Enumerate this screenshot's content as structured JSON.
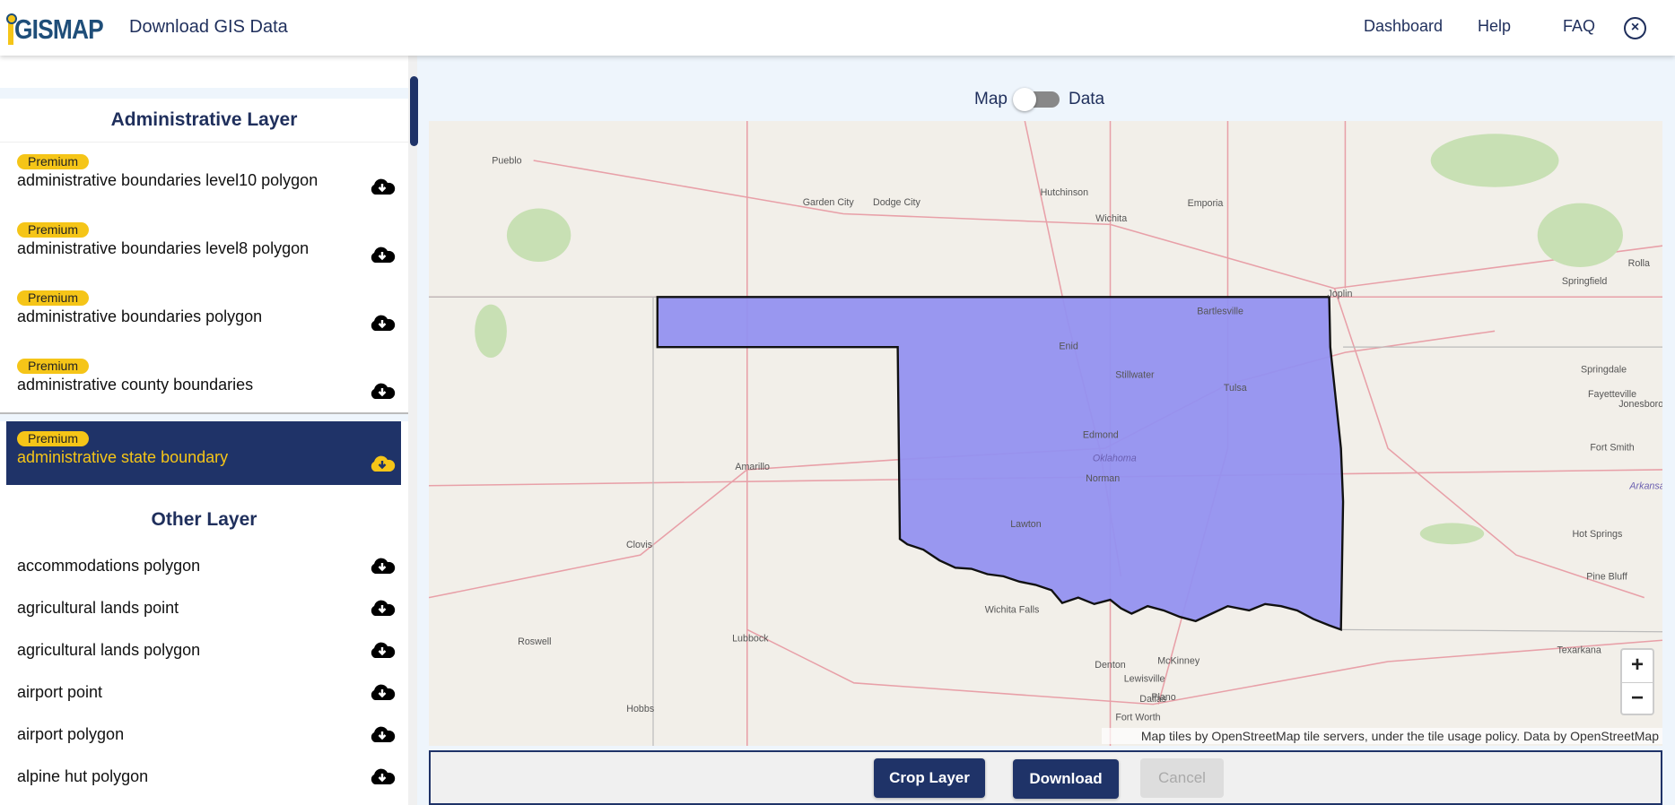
{
  "header": {
    "logo": "iGISMAP",
    "title": "Download GIS Data",
    "nav": [
      "Dashboard",
      "Help",
      "FAQ"
    ],
    "close_icon": "close-circle-icon"
  },
  "sidebar": {
    "admin_title": "Administrative Layer",
    "admin_items": [
      {
        "badge": "Premium",
        "label": "administrative boundaries level10 polygon"
      },
      {
        "badge": "Premium",
        "label": "administrative boundaries level8 polygon"
      },
      {
        "badge": "Premium",
        "label": "administrative boundaries polygon"
      },
      {
        "badge": "Premium",
        "label": "administrative county boundaries"
      },
      {
        "badge": "Premium",
        "label": "administrative state boundary",
        "selected": true
      }
    ],
    "other_title": "Other Layer",
    "other_items": [
      {
        "label": "accommodations polygon"
      },
      {
        "label": "agricultural lands point"
      },
      {
        "label": "agricultural lands polygon"
      },
      {
        "label": "airport point"
      },
      {
        "label": "airport polygon"
      },
      {
        "label": "alpine hut polygon"
      }
    ],
    "download_icon": "cloud-download-icon"
  },
  "view_toggle": {
    "left": "Map",
    "right": "Data",
    "active": "Map"
  },
  "map": {
    "highlight_color": "#9491f0",
    "cities": [
      "Pueblo",
      "Garden City",
      "Dodge City",
      "Hutchinson",
      "Wichita",
      "Emporia",
      "Springfield",
      "Joplin",
      "Bartlesville",
      "Enid",
      "Stillwater",
      "Tulsa",
      "Edmond",
      "Oklahoma",
      "Norman",
      "Lawton",
      "Springdale",
      "Fayetteville",
      "Fort Smith",
      "Amarillo",
      "Clovis",
      "Lubbock",
      "Roswell",
      "Hobbs",
      "Wichita Falls",
      "Denton",
      "McKinney",
      "Lewisville",
      "Plano",
      "Dallas",
      "Fort Worth",
      "Texarkana",
      "Hot Springs",
      "Pine Bluff",
      "Jonesboro",
      "Rolla",
      "Arkansas"
    ],
    "zoom_in": "+",
    "zoom_out": "−",
    "attribution": "Map tiles by OpenStreetMap tile servers, under the tile usage policy. Data by OpenStreetMap"
  },
  "actions": {
    "crop": "Crop Layer",
    "download": "Download",
    "cancel": "Cancel"
  },
  "colors": {
    "navy": "#1f3368",
    "premium": "#f5c518"
  }
}
